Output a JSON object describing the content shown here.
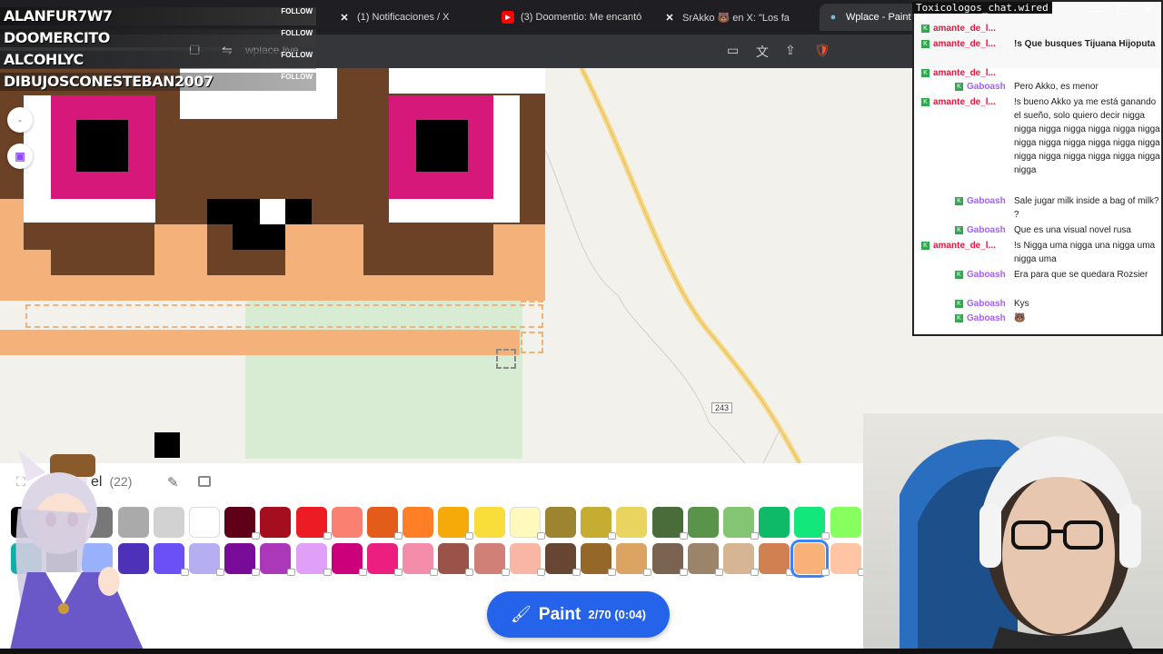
{
  "browser": {
    "tabs": [
      {
        "icon": "x-icon",
        "label": "(1) Notificaciones / X"
      },
      {
        "icon": "youtube-icon",
        "label": "(3) Doomentio: Me encantó"
      },
      {
        "icon": "x-icon",
        "label": "SrAkko 🐻 en X: \"Los fa"
      },
      {
        "icon": "globe-icon",
        "label": "Wplace - Paint the"
      }
    ],
    "url": "wplace.live"
  },
  "follows": [
    {
      "name": "ALANFUR7W7",
      "tag": "FOLLOW"
    },
    {
      "name": "DOOMERCITO",
      "tag": "FOLLOW"
    },
    {
      "name": "ALCOHLYC",
      "tag": "FOLLOW"
    },
    {
      "name": "DIBUJOSCONESTEBAN2007",
      "tag": "FOLLOW"
    }
  ],
  "side_buttons": [
    "-",
    "twitch-icon"
  ],
  "map": {
    "road_label": "243"
  },
  "chat": {
    "title": "Toxicologos_chat.wired",
    "messages": [
      {
        "user": "amante_de_l...",
        "text": "",
        "user_color": "#e0183c"
      },
      {
        "user": "amante_de_l...",
        "text": "!s Que busques Tijuana Hijoputa",
        "user_color": "#e0183c"
      },
      {
        "user": "amante_de_l...",
        "text": "",
        "user_color": "#e0183c"
      },
      {
        "user": "Gaboash",
        "text": "Pero Akko, es menor",
        "user_color": "#a060ff"
      },
      {
        "user": "amante_de_l...",
        "text": "!s bueno Akko ya me está ganando el sueño, solo quiero decir nigga nigga nigga nigga nigga nigga nigga nigga nigga nigga nigga nigga nigga nigga nigga nigga nigga nigga nigga nigga",
        "user_color": "#e0183c"
      },
      {
        "user": "Gaboash",
        "text": "Sale jugar milk inside a bag of milk? ?",
        "user_color": "#a060ff"
      },
      {
        "user": "Gaboash",
        "text": "Que es una visual novel rusa",
        "user_color": "#a060ff"
      },
      {
        "user": "amante_de_l...",
        "text": "!s Nigga uma nigga una nigga uma nigga uma",
        "user_color": "#e0183c"
      },
      {
        "user": "Gaboash",
        "text": "Era para que se quedara Rozsier",
        "user_color": "#a060ff"
      },
      {
        "user": "Gaboash",
        "text": "Kys",
        "user_color": "#a060ff"
      },
      {
        "user": "Gaboash",
        "text": "🐻",
        "user_color": "#a060ff"
      }
    ]
  },
  "panel": {
    "title_partial": "el",
    "count": "(22)"
  },
  "palette": {
    "row1": [
      "#000000",
      "#3c3c3c",
      "#787878",
      "#aaaaaa",
      "#d2d2d2",
      "#ffffff",
      "#600018",
      "#a50e1e",
      "#ed1c24",
      "#fa8072",
      "#e45c1a",
      "#ff7f27",
      "#f6aa09",
      "#f9dd3b",
      "#fffabc",
      "#9c8431",
      "#c5ad31",
      "#e8d45f",
      "#4a6b3a",
      "#5a944a",
      "#84c573",
      "#0eb968",
      "#13e67b",
      "#87ff5e",
      "#0c816e"
    ],
    "row2": [
      "#10aea6",
      "#333941",
      "#99b1fb",
      "#4d31b8",
      "#6b50f6",
      "#b5aef1",
      "#780c99",
      "#aa38b9",
      "#e09ff9",
      "#cb007a",
      "#ec1f80",
      "#f38da9",
      "#9b5249",
      "#d18078",
      "#fab6a4",
      "#684634",
      "#95682a",
      "#dba463",
      "#7b6352",
      "#9c846b",
      "#d6b594",
      "#d18051",
      "#f8b277",
      "#ffc5a5"
    ],
    "selected_index_row2": 22
  },
  "paint_button": {
    "label": "Paint",
    "meta": "2/70 (0:04)"
  }
}
